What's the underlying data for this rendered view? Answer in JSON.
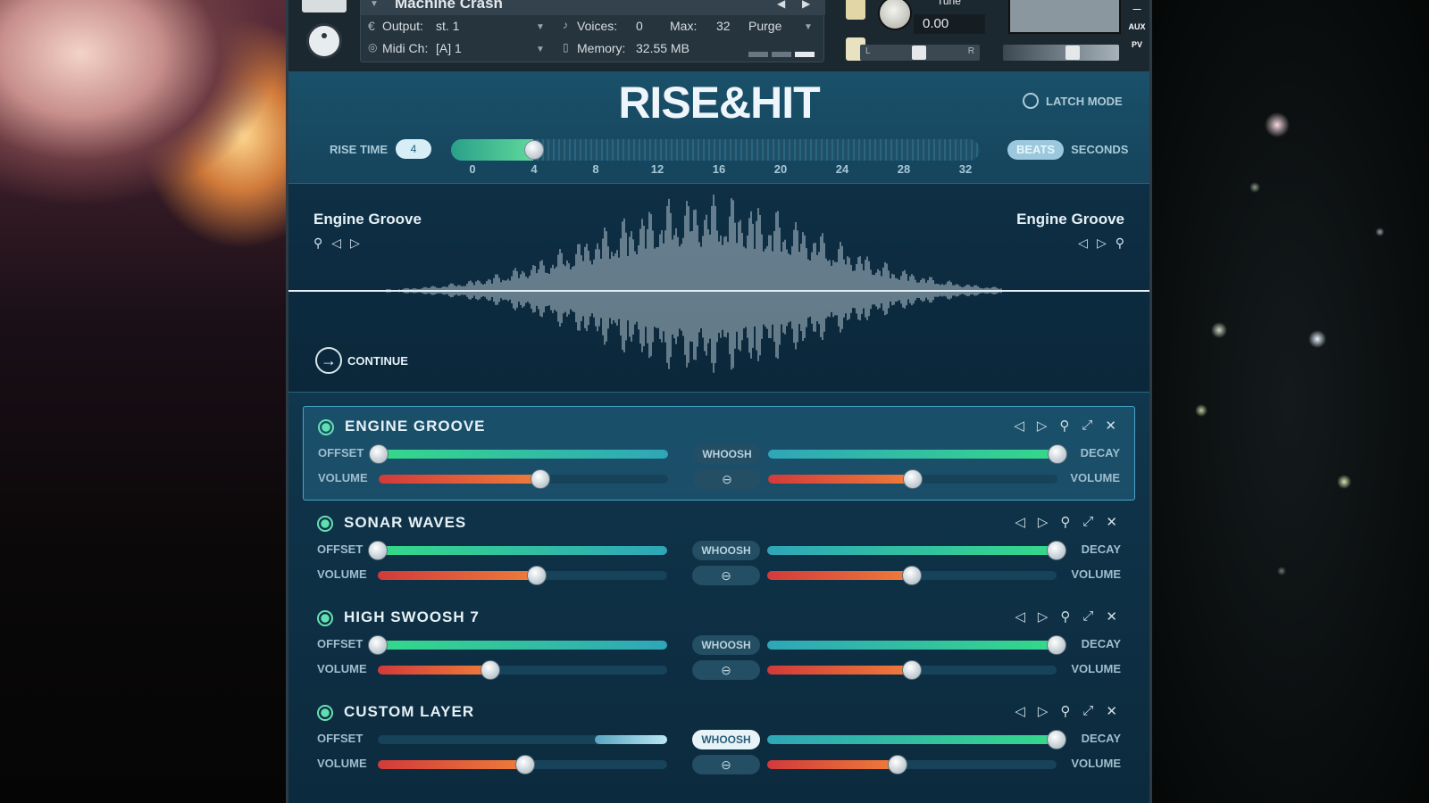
{
  "header": {
    "instrument_name": "Machine Crash",
    "output_label": "Output:",
    "output_value": "st. 1",
    "midi_label": "Midi Ch:",
    "midi_value": "[A] 1",
    "voices_label": "Voices:",
    "voices_value": "0",
    "max_label": "Max:",
    "max_value": "32",
    "memory_label": "Memory:",
    "memory_value": "32.55 MB",
    "purge_label": "Purge",
    "tune_label": "Tune",
    "tune_value": "0.00",
    "pan_left": "L",
    "pan_right": "R",
    "aux_label": "AUX",
    "pv_label": "PV"
  },
  "title": "RISE&HIT",
  "latch_mode": "LATCH MODE",
  "rise_time": {
    "label": "RISE TIME",
    "value": "4",
    "min": 0,
    "max": 32,
    "ticks": [
      "0",
      "4",
      "8",
      "12",
      "16",
      "20",
      "24",
      "28",
      "32"
    ]
  },
  "units": {
    "beats": "BEATS",
    "seconds": "SECONDS",
    "selected": "BEATS"
  },
  "waveform": {
    "left_name": "Engine Groove",
    "right_name": "Engine Groove",
    "continue_label": "CONTINUE"
  },
  "layers": [
    {
      "name": "ENGINE GROOVE",
      "active": true,
      "offset": 0.0,
      "decay": 1.0,
      "volume_left": 0.56,
      "volume_right": 0.5,
      "whoosh_on": false
    },
    {
      "name": "SONAR WAVES",
      "active": false,
      "offset": 0.0,
      "decay": 1.0,
      "volume_left": 0.55,
      "volume_right": 0.5,
      "whoosh_on": false
    },
    {
      "name": "HIGH SWOOSH 7",
      "active": false,
      "offset": 0.0,
      "decay": 1.0,
      "volume_left": 0.39,
      "volume_right": 0.5,
      "whoosh_on": false
    },
    {
      "name": "CUSTOM LAYER",
      "active": false,
      "offset": 0.75,
      "decay": 1.0,
      "volume_left": 0.51,
      "volume_right": 0.45,
      "whoosh_on": true
    }
  ],
  "labels": {
    "offset": "OFFSET",
    "volume": "VOLUME",
    "decay": "DECAY",
    "whoosh": "WHOOSH"
  },
  "icons": {
    "search": "search-icon",
    "prev": "prev-arrow-icon",
    "next": "next-arrow-icon",
    "expand": "expand-icon",
    "close": "close-icon",
    "link": "link-icon"
  }
}
